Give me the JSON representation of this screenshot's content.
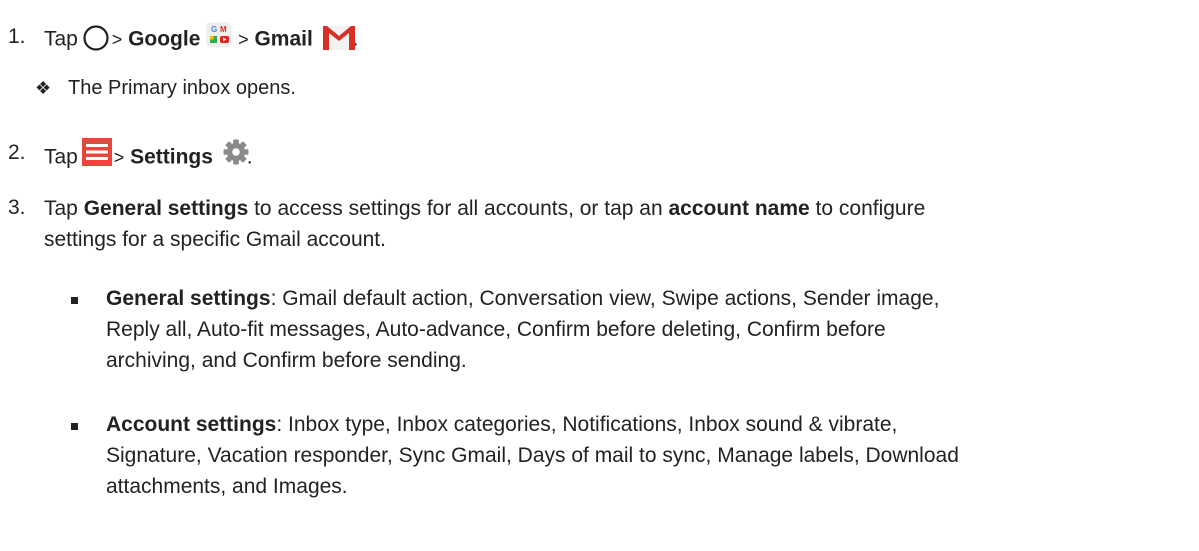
{
  "steps": [
    {
      "number": "1.",
      "tap": "Tap",
      "sep1": ">",
      "google": "Google",
      "sep2": ">",
      "gmail": "Gmail",
      "end": ".",
      "icons": [
        "home-circle-icon",
        "google-folder-icon",
        "gmail-icon"
      ],
      "result": "The Primary inbox opens."
    },
    {
      "number": "2.",
      "tap": "Tap",
      "sep": ">",
      "settings": "Settings",
      "end": ".",
      "icons": [
        "menu-icon",
        "gear-icon"
      ]
    },
    {
      "number": "3.",
      "t1": "Tap ",
      "b1": "General settings",
      "t2": " to access settings for all accounts, or tap an ",
      "b2": "account name",
      "t3": " to configure",
      "line2": "settings for a specific Gmail account."
    }
  ],
  "bullets": [
    {
      "label": "General settings",
      "line1": ": Gmail default action, Conversation view, Swipe actions, Sender image,",
      "line2": "Reply all, Auto-fit messages, Auto-advance, Confirm before deleting, Confirm before",
      "line3": "archiving, and Confirm before sending."
    },
    {
      "label": "Account settings",
      "line1": ": Inbox type, Inbox categories, Notifications, Inbox sound & vibrate,",
      "line2": "Signature, Vacation responder, Sync Gmail, Days of mail to sync, Manage labels, Download",
      "line3": "attachments, and Images."
    }
  ],
  "colors": {
    "menu_red": "#e8453c",
    "gear_gray": "#8a8a8a",
    "gmail_red": "#d93025"
  }
}
